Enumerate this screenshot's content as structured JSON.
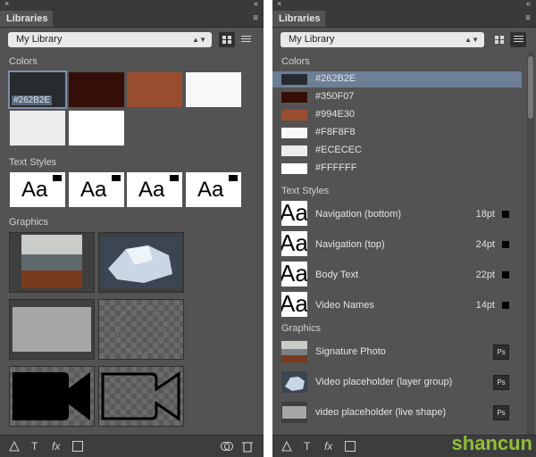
{
  "left_panel": {
    "close_glyph": "×",
    "collapse_glyph": "«",
    "tab": "Libraries",
    "menu_glyph": "≡",
    "library": "My Library",
    "sections": {
      "colors": "Colors",
      "text_styles": "Text Styles",
      "graphics": "Graphics"
    },
    "swatches": [
      {
        "hex": "#262B2E",
        "label": "#262B2E"
      },
      {
        "hex": "#350F07"
      },
      {
        "hex": "#994E30"
      },
      {
        "hex": "#F8F8F8"
      },
      {
        "hex": "#ECECEC"
      },
      {
        "hex": "#FFFFFF"
      }
    ],
    "aa_text": "Aa"
  },
  "right_panel": {
    "tab": "Libraries",
    "library": "My Library",
    "sections": {
      "colors": "Colors",
      "text_styles": "Text Styles",
      "graphics": "Graphics"
    },
    "colors": [
      {
        "hex": "#262B2E",
        "label": "#262B2E"
      },
      {
        "hex": "#350F07",
        "label": "#350F07"
      },
      {
        "hex": "#994E30",
        "label": "#994E30"
      },
      {
        "hex": "#F8F8F8",
        "label": "#F8F8F8"
      },
      {
        "hex": "#ECECEC",
        "label": "#ECECEC"
      },
      {
        "hex": "#FFFFFF",
        "label": "#FFFFFF"
      }
    ],
    "text_styles": [
      {
        "name": "Navigation (bottom)",
        "size": "18pt"
      },
      {
        "name": "Navigation (top)",
        "size": "24pt"
      },
      {
        "name": "Body Text",
        "size": "22pt"
      },
      {
        "name": "Video Names",
        "size": "14pt"
      }
    ],
    "graphics": [
      {
        "name": "Signature Photo",
        "badge": "Ps"
      },
      {
        "name": "Video placeholder (layer group)",
        "badge": "Ps"
      },
      {
        "name": "video placeholder (live shape)",
        "badge": "Ps"
      }
    ]
  },
  "footer": {
    "text_glyph": "T",
    "fx_glyph": "fx"
  },
  "watermark": "shancun"
}
